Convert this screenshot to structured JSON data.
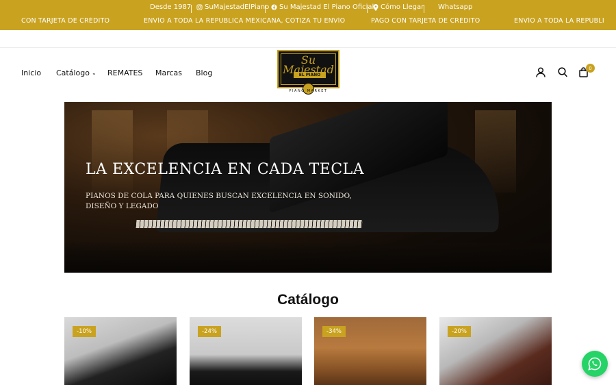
{
  "colors": {
    "accent": "#c9a21f",
    "whatsapp": "#25d366"
  },
  "topbar": {
    "since": "Desde 1987",
    "instagram": "SuMajestadElPiano",
    "facebook": "Su Majestad El Piano Oficial",
    "directions": "Cómo Llegar",
    "whatsapp": "Whatsapp",
    "marquee": [
      "CON TARJETA DE CRÉDITO",
      "ENVÍO A TODA LA REPUBLICA MÉXICANA, COTIZA TU ENVÍO",
      "PAGO CON TARJETA DE CRÉDITO",
      "ENVÍO A TODA LA REPUBLI"
    ]
  },
  "nav": {
    "items": [
      "Inicio",
      "Catálogo",
      "REMATES",
      "Marcas",
      "Blog"
    ],
    "cart_count": "0"
  },
  "logo": {
    "script": "Su Majestad",
    "el_piano": "EL PIANO",
    "market": "PIANO MARKET"
  },
  "hero": {
    "title": "LA EXCELENCIA EN CADA TECLA",
    "subtitle": "PIANOS DE COLA PARA QUIENES BUSCAN EXCELENCIA EN SONIDO, DISEÑO Y LEGADO"
  },
  "catalog": {
    "title": "Catálogo",
    "products": [
      {
        "discount": "-10%"
      },
      {
        "discount": "-24%"
      },
      {
        "discount": "-34%"
      },
      {
        "discount": "-20%"
      }
    ]
  },
  "icons": {
    "instagram": "instagram-icon",
    "facebook": "facebook-icon",
    "directions": "map-pin-icon",
    "account": "user-icon",
    "search": "search-icon",
    "cart": "bag-icon",
    "chat": "whatsapp-icon"
  }
}
